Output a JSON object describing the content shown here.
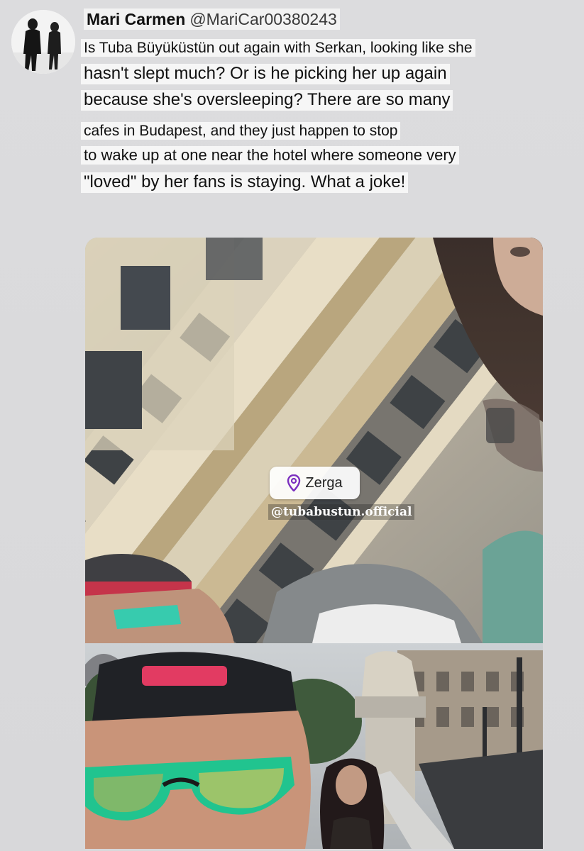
{
  "tweet": {
    "author_name": "Mari Carmen",
    "author_handle": "@MariCar00380243",
    "lines": [
      "Is Tuba Büyüküstün out again with Serkan, looking like she",
      "hasn't slept much? Or is he picking her up again",
      "because she's oversleeping? There are so many",
      "cafes in Budapest, and they just happen to stop",
      "to wake up at one near the hotel where someone very",
      "\"loved\" by her fans is staying. What a joke!"
    ]
  },
  "media": {
    "location_sticker": {
      "icon": "location-pin-icon",
      "label": "Zerga",
      "accent": "#7b2fbf"
    },
    "mention_tag": "@tubabustun.official"
  },
  "colors": {
    "background": "#d9d9db",
    "text_highlight": "#f6f6f6"
  }
}
